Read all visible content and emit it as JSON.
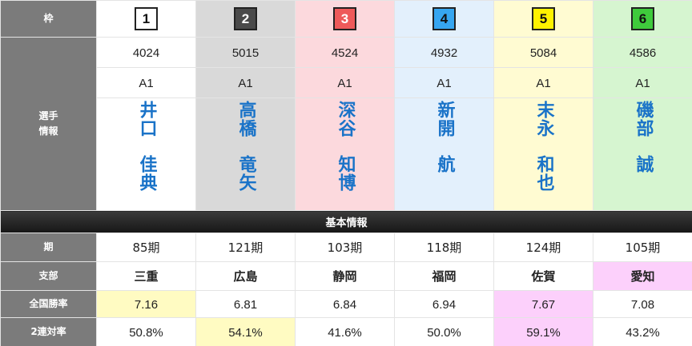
{
  "labels": {
    "frame": "枠",
    "racer_info": [
      "選手",
      "情報"
    ],
    "section": "基本情報",
    "term": "期",
    "branch": "支部",
    "national_win_rate": "全国勝率",
    "two_place_rate": "2連対率"
  },
  "racers": [
    {
      "frame": "1",
      "frame_bg": "#ffffff",
      "frame_fg": "#111111",
      "reg_no": "4024",
      "class": "A1",
      "family_name": "井口",
      "given_name": "佳典",
      "term": "85期",
      "branch": "三重",
      "win_rate": "7.16",
      "two_rate": "50.8%"
    },
    {
      "frame": "2",
      "frame_bg": "#4a4a4a",
      "frame_fg": "#ffffff",
      "reg_no": "5015",
      "class": "A1",
      "family_name": "高橋",
      "given_name": "竜矢",
      "term": "121期",
      "branch": "広島",
      "win_rate": "6.81",
      "two_rate": "54.1%"
    },
    {
      "frame": "3",
      "frame_bg": "#ee5a5a",
      "frame_fg": "#ffffff",
      "reg_no": "4524",
      "class": "A1",
      "family_name": "深谷",
      "given_name": "知博",
      "term": "103期",
      "branch": "静岡",
      "win_rate": "6.84",
      "two_rate": "41.6%"
    },
    {
      "frame": "4",
      "frame_bg": "#36a6f0",
      "frame_fg": "#111111",
      "reg_no": "4932",
      "class": "A1",
      "family_name": "新開",
      "given_name": "航",
      "term": "118期",
      "branch": "福岡",
      "win_rate": "6.94",
      "two_rate": "50.0%"
    },
    {
      "frame": "5",
      "frame_bg": "#fff200",
      "frame_fg": "#111111",
      "reg_no": "5084",
      "class": "A1",
      "family_name": "末永",
      "given_name": "和也",
      "term": "124期",
      "branch": "佐賀",
      "win_rate": "7.67",
      "two_rate": "59.1%"
    },
    {
      "frame": "6",
      "frame_bg": "#3fcb3c",
      "frame_fg": "#111111",
      "reg_no": "4586",
      "class": "A1",
      "family_name": "磯部",
      "given_name": "誠",
      "term": "105期",
      "branch": "愛知",
      "win_rate": "7.08",
      "two_rate": "43.2%"
    }
  ],
  "highlights": {
    "branch": {
      "5": "pink"
    },
    "win_rate": {
      "0": "yellow",
      "4": "pink"
    },
    "two_rate": {
      "1": "yellow",
      "4": "pink"
    }
  },
  "colors": {
    "name_text": "#1a73c8",
    "label_bg": "#7b7b7b",
    "highlight_yellow": "#fffbc2",
    "highlight_pink": "#fcd0fb"
  }
}
